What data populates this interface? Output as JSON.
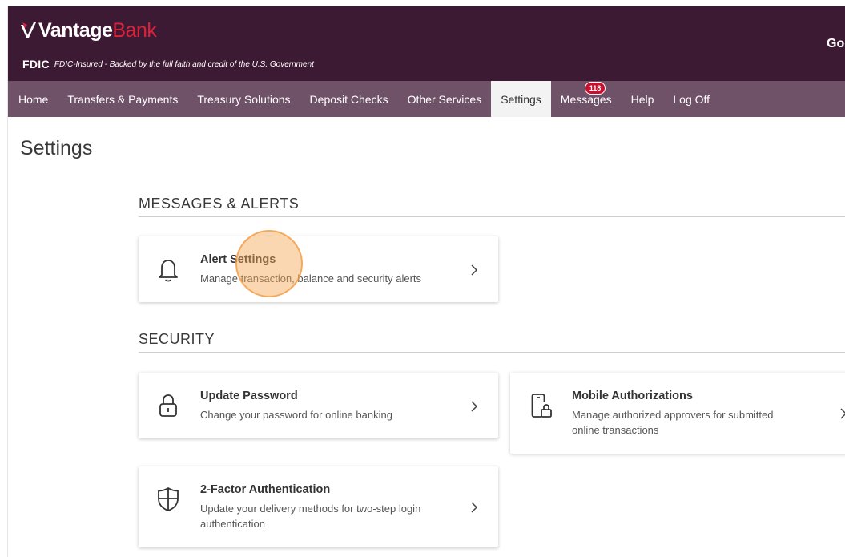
{
  "brand": {
    "logo_part1": "Vantage",
    "logo_part2": "Bank",
    "fdic_badge": "FDIC",
    "fdic_text": "FDIC-Insured - Backed by the full faith and credit of the U.S. Government",
    "greeting": "Goo",
    "colors": {
      "header": "#3d1a33",
      "nav": "#6f5168",
      "logo_red": "#d8233a"
    }
  },
  "nav": {
    "items": [
      {
        "label": "Home"
      },
      {
        "label": "Transfers & Payments"
      },
      {
        "label": "Treasury Solutions"
      },
      {
        "label": "Deposit Checks"
      },
      {
        "label": "Other Services"
      },
      {
        "label": "Settings",
        "active": true
      },
      {
        "label": "Messages",
        "badge": "118"
      },
      {
        "label": "Help"
      },
      {
        "label": "Log Off"
      }
    ]
  },
  "page": {
    "title": "Settings"
  },
  "sections": {
    "messages": {
      "title": "MESSAGES & ALERTS",
      "cards": [
        {
          "title": "Alert Settings",
          "desc": "Manage transaction, balance and security alerts",
          "icon": "bell-icon"
        }
      ]
    },
    "security": {
      "title": "SECURITY",
      "cards": [
        {
          "title": "Update Password",
          "desc": "Change your password for online banking",
          "icon": "lock-icon"
        },
        {
          "title": "Mobile Authorizations",
          "desc_line1": "Manage authorized approvers for submitted",
          "desc_line2": "online transactions",
          "icon": "mobile-lock-icon"
        },
        {
          "title": "2-Factor Authentication",
          "desc_line1": "Update your delivery methods for two-step login",
          "desc_line2": "authentication",
          "icon": "shield-icon"
        }
      ]
    }
  }
}
